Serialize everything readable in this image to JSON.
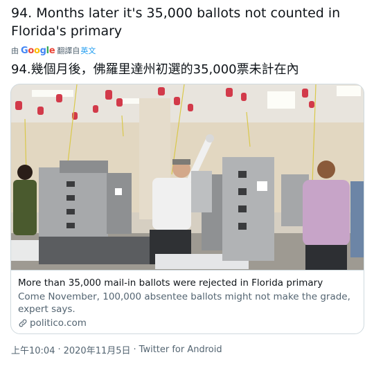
{
  "tweet": {
    "text": "94. Months later it's 35,000 ballots not counted in Florida's primary",
    "translation_prefix": "由",
    "translation_provider": "Google",
    "translation_suffix": "翻譯自",
    "translation_language": "英文",
    "translated_text": "94.幾個月後，佛羅里達州初選的35,000票未計在內"
  },
  "card": {
    "title": "More than 35,000 mail-in ballots were rejected in Florida primary",
    "description": "Come November, 100,000 absentee ballots might not make the grade, expert says.",
    "domain": "politico.com",
    "image_icon": "photo-ballot-counting"
  },
  "meta": {
    "time": "上午10:04",
    "date": "2020年11月5日",
    "separator": "·",
    "source": "Twitter for Android"
  },
  "colors": {
    "text": "#0f1419",
    "secondary": "#536471",
    "link": "#1d9bf0",
    "border": "#cfd9de"
  }
}
